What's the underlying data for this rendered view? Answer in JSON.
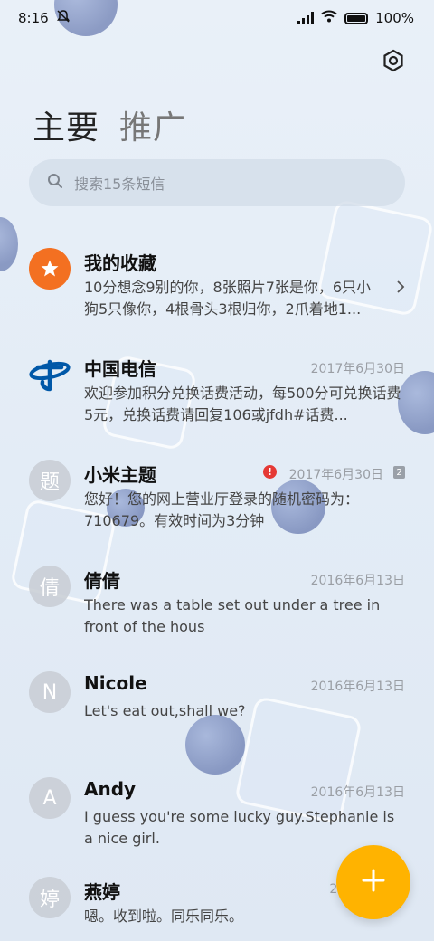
{
  "status_bar": {
    "time": "8:16",
    "battery": "100%"
  },
  "tabs": [
    {
      "label": "主要"
    },
    {
      "label": "推广"
    }
  ],
  "search": {
    "placeholder": "搜索15条短信"
  },
  "conversations": [
    {
      "avatar": "★",
      "name": "我的收藏",
      "date": "",
      "snippet": "10分想念9别的你，8张照片7张是你，6只小狗5只像你，4根骨头3根归你，2爪着地1..."
    },
    {
      "avatar": "",
      "name": "中国电信",
      "date": "2017年6月30日",
      "snippet": "欢迎参加积分兑换话费活动，每500分可兑换话费5元，兑换话费请回复106或jfdh#话费..."
    },
    {
      "avatar": "题",
      "name": "小米主题",
      "date": "2017年6月30日",
      "badge": "2",
      "snippet": "您好！您的网上营业厅登录的随机密码为：710679。有效时间为3分钟"
    },
    {
      "avatar": "倩",
      "name": "倩倩",
      "date": "2016年6月13日",
      "snippet": "There was a table set out under a tree in front of the hous"
    },
    {
      "avatar": "N",
      "name": "Nicole",
      "date": "2016年6月13日",
      "snippet": "Let's eat out,shall we?"
    },
    {
      "avatar": "A",
      "name": "Andy",
      "date": "2016年6月13日",
      "snippet": "I guess you're some lucky guy.Stephanie is a nice girl."
    },
    {
      "avatar": "婷",
      "name": "燕婷",
      "date": "2013",
      "snippet": "嗯。收到啦。同乐同乐。"
    }
  ],
  "icons": {
    "settings": "gear-icon",
    "search": "search-icon",
    "compose": "plus-icon",
    "favorite": "star-icon"
  },
  "colors": {
    "accent_fab": "#ffb300",
    "favorite": "#f37021",
    "telecom_blue": "#0058a8",
    "error": "#e53935"
  }
}
